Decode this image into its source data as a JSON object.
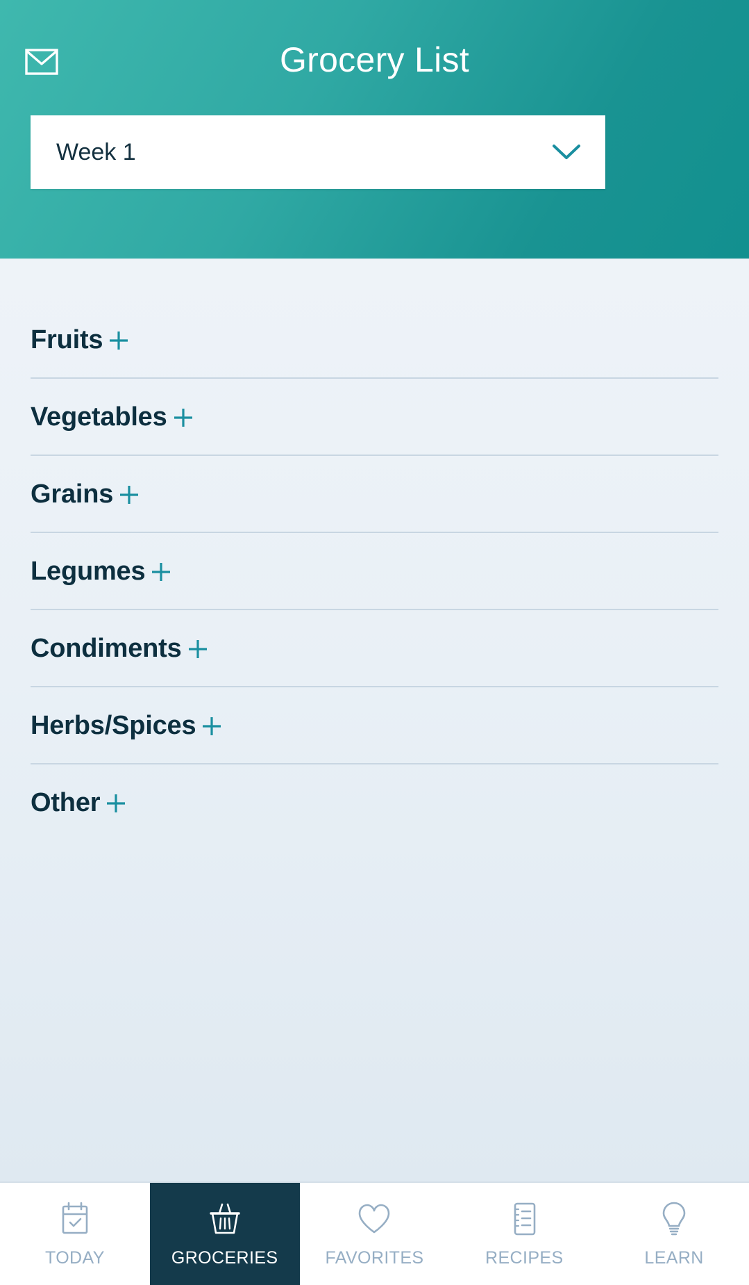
{
  "header": {
    "title": "Grocery List",
    "mail_icon": "mail-icon",
    "week_selector": {
      "value": "Week 1",
      "chevron_icon": "chevron-down-icon"
    },
    "gradient_from": "#3fb8ae",
    "gradient_to": "#12908f"
  },
  "colors": {
    "accent_teal": "#1a8fa0",
    "text_dark": "#0d2f3f",
    "nav_active_bg": "#143A4B",
    "nav_inactive": "#96aec4",
    "divider": "#c8d6e2"
  },
  "categories": [
    {
      "label": "Fruits",
      "add_icon": "plus-icon"
    },
    {
      "label": "Vegetables",
      "add_icon": "plus-icon"
    },
    {
      "label": "Grains",
      "add_icon": "plus-icon"
    },
    {
      "label": "Legumes",
      "add_icon": "plus-icon"
    },
    {
      "label": "Condiments",
      "add_icon": "plus-icon"
    },
    {
      "label": "Herbs/Spices",
      "add_icon": "plus-icon"
    },
    {
      "label": "Other",
      "add_icon": "plus-icon"
    }
  ],
  "bottom_nav": {
    "items": [
      {
        "label": "TODAY",
        "icon": "calendar-check-icon",
        "active": false
      },
      {
        "label": "GROCERIES",
        "icon": "basket-icon",
        "active": true
      },
      {
        "label": "FAVORITES",
        "icon": "heart-icon",
        "active": false
      },
      {
        "label": "RECIPES",
        "icon": "notebook-icon",
        "active": false
      },
      {
        "label": "LEARN",
        "icon": "lightbulb-icon",
        "active": false
      }
    ]
  }
}
